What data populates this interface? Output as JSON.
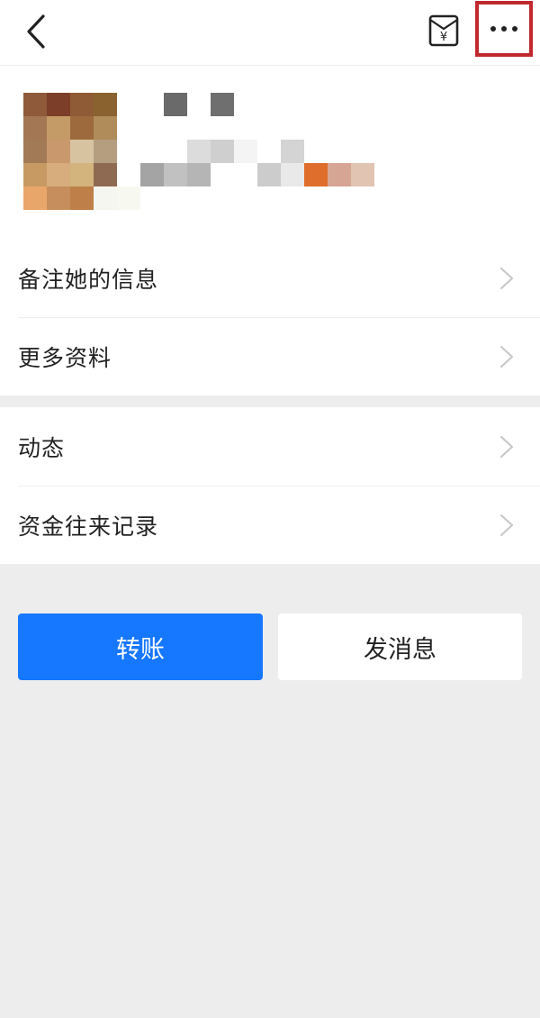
{
  "header": {
    "back_icon": "chevron-left-icon",
    "bill_icon": "yuan-bill-icon",
    "bill_symbol": "¥",
    "more_icon": "more-dots-icon",
    "highlight_color": "#c0282d"
  },
  "profile": {
    "avatar_mosaic": [
      "#8e5a3a",
      "#7c3e28",
      "#8f5a36",
      "#8a6230",
      "#ffffff",
      "#a37753",
      "#c49a66",
      "#9c6a3c",
      "#b08c5a",
      "#ffffff",
      "#a27a55",
      "#c9996d",
      "#d8c3a0",
      "#b59d80",
      "#ffffff",
      "#c89a63",
      "#d7ad7d",
      "#d3b47d",
      "#8f6a52",
      "#ffffff",
      "#e9a66b",
      "#c58e5c",
      "#be7f48",
      "#f6f6f0",
      "#f7f9f1"
    ],
    "name_mosaic": [
      "#ffffff",
      "#6a6a6a",
      "#ffffff",
      "#6f6f6f",
      "#ffffff",
      "#ffffff",
      "#ffffff",
      "#ffffff",
      "#ffffff",
      "#ffffff",
      "#ffffff",
      "#ffffff",
      "#ffffff",
      "#ffffff",
      "#ffffff",
      "#ffffff",
      "#ffffff",
      "#ffffff",
      "#ffffff",
      "#ffffff",
      "#ffffff",
      "#ffffff",
      "#dcdcdc",
      "#cfcfcf",
      "#f4f4f4",
      "#ffffff",
      "#d4d4d4",
      "#ffffff",
      "#ffffff",
      "#ffffff",
      "#a4a4a4",
      "#c1c1c1",
      "#b5b5b5",
      "#ffffff",
      "#ffffff",
      "#cccccc",
      "#e9e9e9",
      "#df6d2b",
      "#d7a593",
      "#e2c4b2"
    ]
  },
  "menu_group_1": [
    {
      "label": "备注她的信息"
    },
    {
      "label": "更多资料"
    }
  ],
  "menu_group_2": [
    {
      "label": "动态"
    },
    {
      "label": "资金往来记录"
    }
  ],
  "actions": {
    "transfer_label": "转账",
    "message_label": "发消息",
    "transfer_color": "#1677ff"
  }
}
